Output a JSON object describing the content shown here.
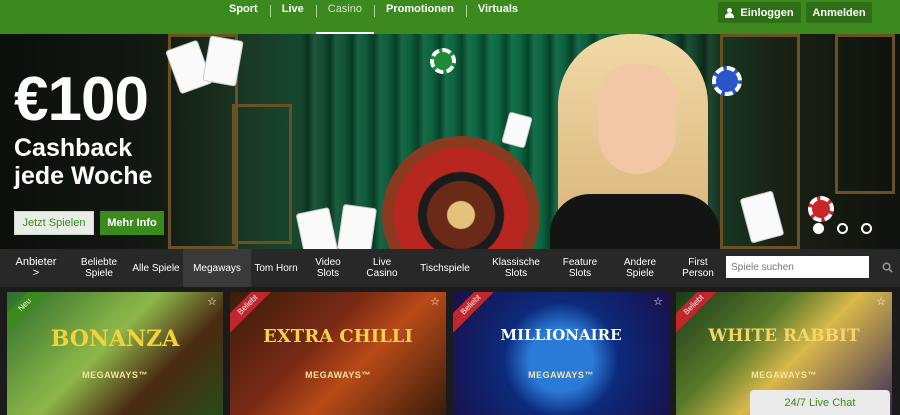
{
  "brand": {
    "accent": "#3c8a1d",
    "dark": "#2e6e15"
  },
  "topnav": {
    "items": [
      {
        "label": "Sport"
      },
      {
        "label": "Live"
      },
      {
        "label": "Casino"
      },
      {
        "label": "Promotionen"
      },
      {
        "label": "Virtuals"
      }
    ],
    "active": "Casino",
    "login_label": "Einloggen",
    "register_label": "Anmelden"
  },
  "hero": {
    "amount": "€100",
    "line1": "Cashback",
    "line2": "jede Woche",
    "play_label": "Jetzt Spielen",
    "info_label": "Mehr Info",
    "slides": 3,
    "active_slide": 1
  },
  "categories": {
    "provider_label": "Anbieter >",
    "items": [
      {
        "label": "Beliebte Spiele"
      },
      {
        "label": "Alle Spiele"
      },
      {
        "label": "Megaways"
      },
      {
        "label": "Tom Horn"
      },
      {
        "label": "Video Slots"
      },
      {
        "label": "Live Casino"
      },
      {
        "label": "Tischspiele"
      },
      {
        "label": "Klassische Slots"
      },
      {
        "label": "Feature Slots"
      },
      {
        "label": "Andere Spiele"
      },
      {
        "label": "First Person"
      }
    ],
    "active": "Megaways",
    "search_placeholder": "Spiele suchen"
  },
  "games": [
    {
      "title": "BONANZA",
      "subtitle": "MEGAWAYS™",
      "badge": "Neu",
      "badge_color": "#3c8a1d"
    },
    {
      "title": "EXTRA CHILLI",
      "subtitle": "MEGAWAYS™",
      "badge": "Beliebt",
      "badge_color": "#c0262a"
    },
    {
      "title": "MILLIONAIRE",
      "subtitle": "MEGAWAYS™",
      "badge": "Beliebt",
      "badge_color": "#c0262a"
    },
    {
      "title": "WHITE RABBIT",
      "subtitle": "MEGAWAYS™",
      "badge": "Beliebt",
      "badge_color": "#c0262a"
    }
  ],
  "chat": {
    "label": "24/7 Live Chat"
  }
}
